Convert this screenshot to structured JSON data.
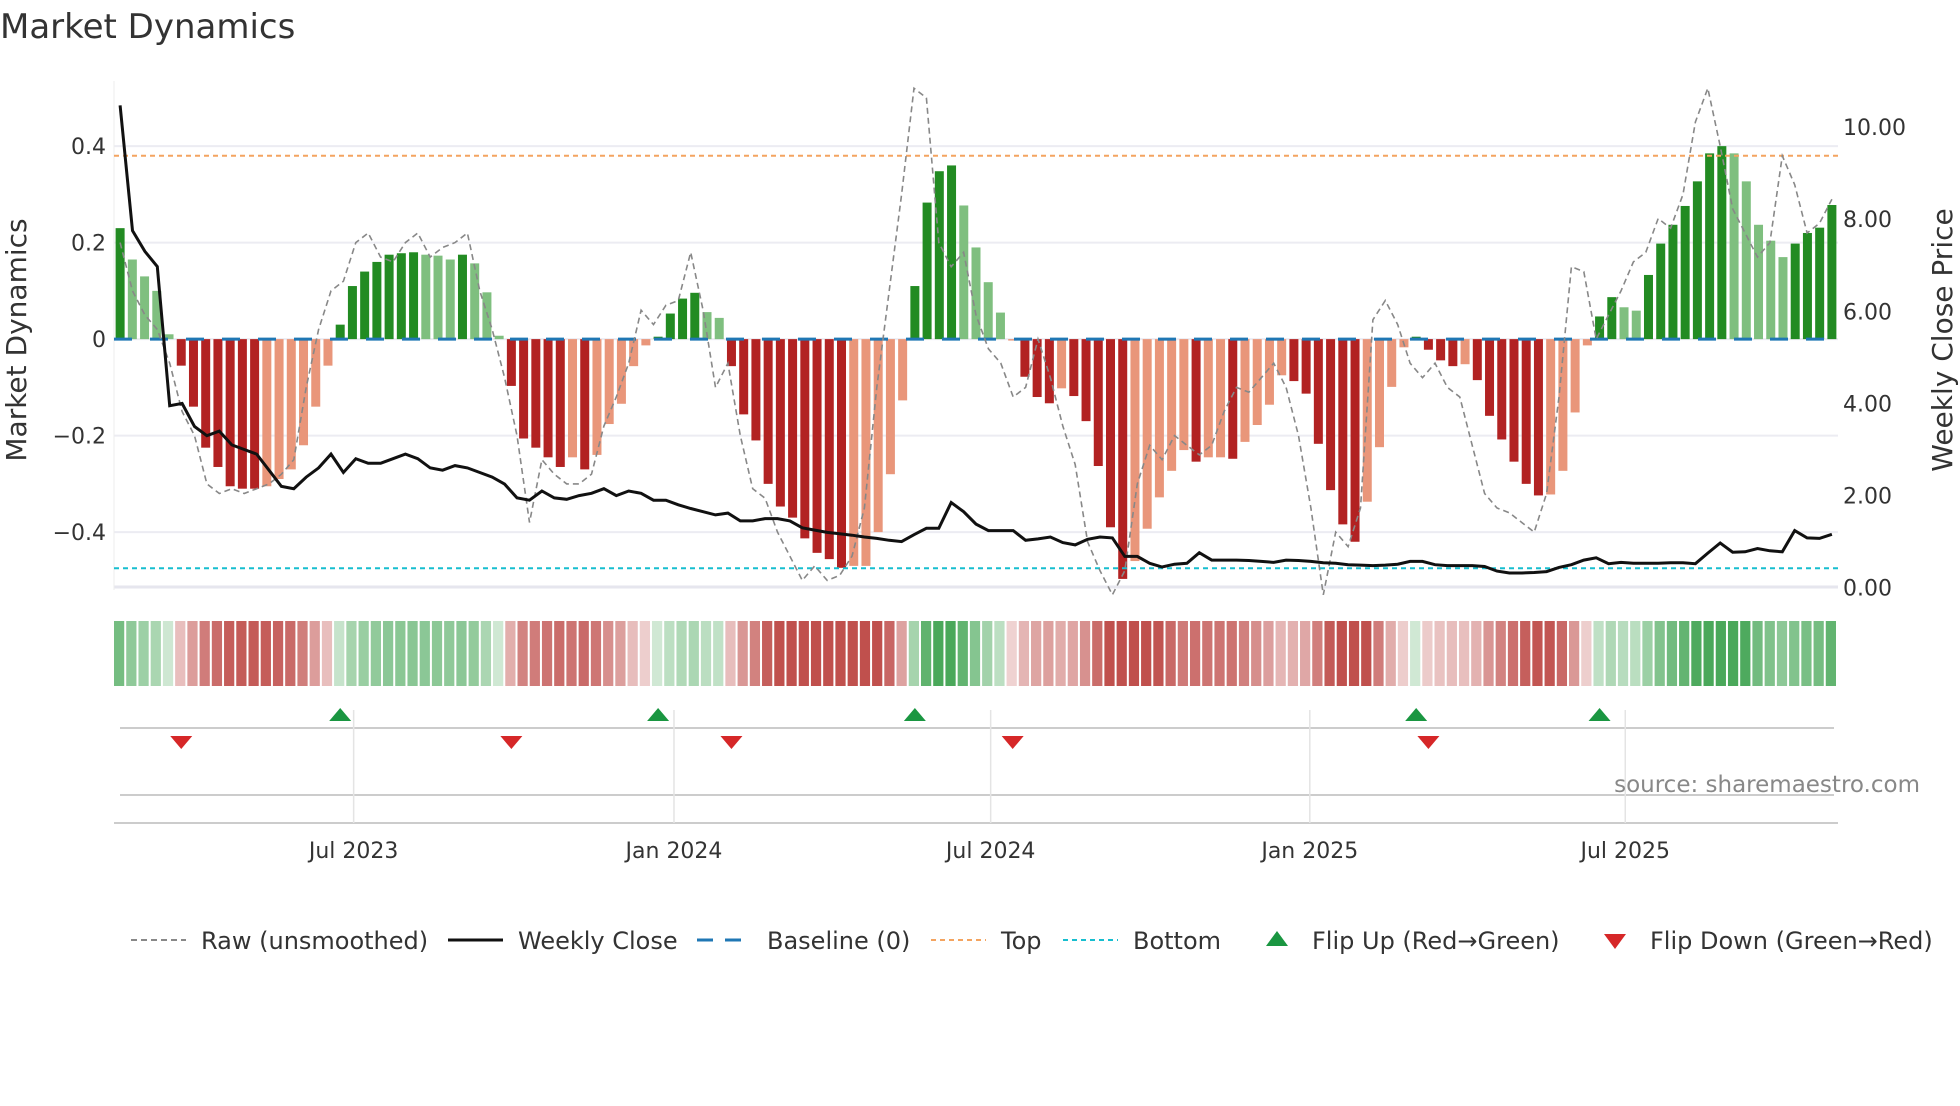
{
  "chart_data": {
    "type": "bar",
    "title": "Market Dynamics",
    "ylabel": "Market Dynamics",
    "y2label": "Weekly Close Price",
    "ylim": [
      -0.52,
      0.535
    ],
    "y2lim": [
      -0.05,
      11.0
    ],
    "yticks": [
      {
        "v": 0.4,
        "label": "0.4"
      },
      {
        "v": 0.2,
        "label": "0.2"
      },
      {
        "v": 0,
        "label": "0"
      },
      {
        "v": -0.2,
        "label": "−0.2"
      },
      {
        "v": -0.4,
        "label": "−0.4"
      }
    ],
    "y2ticks": [
      {
        "v": 10,
        "label": "10.00"
      },
      {
        "v": 8,
        "label": "8.00"
      },
      {
        "v": 6,
        "label": "6.00"
      },
      {
        "v": 4,
        "label": "4.00"
      },
      {
        "v": 2,
        "label": "2.00"
      },
      {
        "v": 0,
        "label": "0.00"
      }
    ],
    "xticks": [
      {
        "week": 19.6,
        "label": "Jul 2023"
      },
      {
        "week": 45.8,
        "label": "Jan 2024"
      },
      {
        "week": 71.7,
        "label": "Jul 2024"
      },
      {
        "week": 97.8,
        "label": "Jan 2025"
      },
      {
        "week": 123.6,
        "label": "Jul 2025"
      }
    ],
    "top_level": 0.38,
    "bottom_level": -0.475,
    "baseline": 0,
    "colors": {
      "green_strong": "#228b22",
      "green_weak": "#7fbf7f",
      "red_strong": "#b22222",
      "red_weak": "#e9967a",
      "top": "#f4a460",
      "bottom": "#17becf",
      "baseline": "#1f77b4",
      "flip_up": "#1a9641",
      "flip_down": "#d62728"
    },
    "smoothed": [
      0.23,
      0.165,
      0.13,
      0.1,
      0.01,
      -0.055,
      -0.14,
      -0.225,
      -0.265,
      -0.305,
      -0.31,
      -0.31,
      -0.305,
      -0.29,
      -0.27,
      -0.22,
      -0.14,
      -0.055,
      0.03,
      0.11,
      0.14,
      0.16,
      0.175,
      0.178,
      0.18,
      0.175,
      0.173,
      0.165,
      0.175,
      0.157,
      0.097,
      0.007,
      -0.097,
      -0.206,
      -0.225,
      -0.245,
      -0.265,
      -0.245,
      -0.27,
      -0.24,
      -0.176,
      -0.134,
      -0.056,
      -0.013,
      0.005,
      0.053,
      0.084,
      0.096,
      0.056,
      0.044,
      -0.056,
      -0.156,
      -0.21,
      -0.3,
      -0.347,
      -0.37,
      -0.413,
      -0.443,
      -0.456,
      -0.474,
      -0.47,
      -0.47,
      -0.4,
      -0.28,
      -0.127,
      0.11,
      0.283,
      0.348,
      0.36,
      0.277,
      0.19,
      0.118,
      0.055,
      -0.003,
      -0.078,
      -0.12,
      -0.133,
      -0.102,
      -0.118,
      -0.17,
      -0.263,
      -0.39,
      -0.497,
      -0.46,
      -0.393,
      -0.328,
      -0.273,
      -0.23,
      -0.254,
      -0.245,
      -0.245,
      -0.248,
      -0.213,
      -0.178,
      -0.136,
      -0.075,
      -0.087,
      -0.113,
      -0.217,
      -0.313,
      -0.384,
      -0.42,
      -0.337,
      -0.224,
      -0.099,
      -0.017,
      0.005,
      -0.022,
      -0.044,
      -0.056,
      -0.052,
      -0.085,
      -0.159,
      -0.208,
      -0.254,
      -0.3,
      -0.324,
      -0.322,
      -0.273,
      -0.152,
      -0.013,
      0.047,
      0.087,
      0.066,
      0.059,
      0.133,
      0.198,
      0.237,
      0.276,
      0.327,
      0.385,
      0.4,
      0.385,
      0.327,
      0.237,
      0.204,
      0.17,
      0.198,
      0.22,
      0.231,
      0.278
    ],
    "strength": [
      "s",
      "w",
      "w",
      "w",
      "w",
      "s",
      "s",
      "s",
      "s",
      "s",
      "s",
      "s",
      "w",
      "w",
      "w",
      "w",
      "w",
      "w",
      "s",
      "s",
      "s",
      "s",
      "s",
      "s",
      "s",
      "w",
      "w",
      "w",
      "s",
      "w",
      "w",
      "w",
      "s",
      "s",
      "s",
      "s",
      "s",
      "w",
      "s",
      "w",
      "w",
      "w",
      "w",
      "w",
      "s",
      "s",
      "s",
      "s",
      "w",
      "w",
      "s",
      "s",
      "s",
      "s",
      "s",
      "s",
      "s",
      "s",
      "s",
      "s",
      "w",
      "w",
      "w",
      "w",
      "w",
      "s",
      "s",
      "s",
      "s",
      "w",
      "w",
      "w",
      "w",
      "w",
      "s",
      "s",
      "s",
      "w",
      "s",
      "s",
      "s",
      "s",
      "s",
      "w",
      "w",
      "w",
      "w",
      "w",
      "s",
      "w",
      "w",
      "s",
      "w",
      "w",
      "w",
      "w",
      "s",
      "s",
      "s",
      "s",
      "s",
      "s",
      "w",
      "w",
      "w",
      "w",
      "s",
      "s",
      "s",
      "s",
      "w",
      "s",
      "s",
      "s",
      "s",
      "s",
      "s",
      "w",
      "w",
      "w",
      "w",
      "s",
      "s",
      "w",
      "w",
      "s",
      "s",
      "s",
      "s",
      "s",
      "s",
      "s",
      "w",
      "w",
      "w",
      "w",
      "w",
      "s",
      "s",
      "s",
      "s"
    ],
    "raw": [
      0.2,
      0.1,
      0.05,
      0.02,
      -0.05,
      -0.15,
      -0.2,
      -0.3,
      -0.32,
      -0.31,
      -0.32,
      -0.31,
      -0.3,
      -0.28,
      -0.25,
      -0.1,
      0.02,
      0.1,
      0.12,
      0.2,
      0.22,
      0.17,
      0.16,
      0.2,
      0.22,
      0.17,
      0.19,
      0.2,
      0.22,
      0.1,
      0.02,
      -0.08,
      -0.2,
      -0.38,
      -0.25,
      -0.28,
      -0.3,
      -0.3,
      -0.28,
      -0.18,
      -0.12,
      -0.05,
      0.06,
      0.03,
      0.07,
      0.08,
      0.18,
      0.06,
      -0.1,
      -0.05,
      -0.2,
      -0.31,
      -0.33,
      -0.4,
      -0.45,
      -0.5,
      -0.47,
      -0.5,
      -0.49,
      -0.45,
      -0.35,
      -0.1,
      0.1,
      0.3,
      0.52,
      0.5,
      0.2,
      0.15,
      0.18,
      0.05,
      -0.02,
      -0.05,
      -0.12,
      -0.1,
      0.0,
      -0.08,
      -0.18,
      -0.26,
      -0.42,
      -0.48,
      -0.53,
      -0.48,
      -0.3,
      -0.22,
      -0.25,
      -0.2,
      -0.22,
      -0.24,
      -0.22,
      -0.15,
      -0.1,
      -0.11,
      -0.08,
      -0.05,
      -0.1,
      -0.2,
      -0.35,
      -0.53,
      -0.4,
      -0.43,
      -0.35,
      0.04,
      0.08,
      0.03,
      -0.05,
      -0.08,
      -0.05,
      -0.1,
      -0.12,
      -0.22,
      -0.32,
      -0.35,
      -0.36,
      -0.38,
      -0.4,
      -0.32,
      -0.12,
      0.15,
      0.14,
      0.0,
      0.05,
      0.1,
      0.16,
      0.18,
      0.25,
      0.23,
      0.3,
      0.45,
      0.52,
      0.4,
      0.27,
      0.22,
      0.17,
      0.2,
      0.38,
      0.32,
      0.22,
      0.24,
      0.29
    ],
    "weekly_close": [
      10.47,
      7.75,
      7.3,
      6.97,
      3.95,
      4.0,
      3.5,
      3.3,
      3.4,
      3.1,
      3.0,
      2.9,
      2.55,
      2.2,
      2.15,
      2.4,
      2.6,
      2.9,
      2.5,
      2.8,
      2.7,
      2.7,
      2.8,
      2.9,
      2.8,
      2.6,
      2.55,
      2.65,
      2.6,
      2.5,
      2.4,
      2.25,
      1.95,
      1.9,
      2.1,
      1.95,
      1.92,
      2.0,
      2.05,
      2.15,
      2.0,
      2.1,
      2.05,
      1.9,
      1.9,
      1.8,
      1.72,
      1.65,
      1.58,
      1.62,
      1.45,
      1.45,
      1.5,
      1.5,
      1.45,
      1.3,
      1.25,
      1.2,
      1.17,
      1.14,
      1.1,
      1.07,
      1.03,
      1.0,
      1.15,
      1.29,
      1.29,
      1.85,
      1.65,
      1.38,
      1.24,
      1.24,
      1.24,
      1.03,
      1.06,
      1.1,
      0.98,
      0.93,
      1.05,
      1.1,
      1.08,
      0.68,
      0.68,
      0.53,
      0.45,
      0.51,
      0.53,
      0.76,
      0.6,
      0.6,
      0.6,
      0.59,
      0.57,
      0.55,
      0.6,
      0.59,
      0.57,
      0.54,
      0.53,
      0.5,
      0.49,
      0.48,
      0.49,
      0.51,
      0.57,
      0.57,
      0.5,
      0.48,
      0.48,
      0.48,
      0.46,
      0.36,
      0.32,
      0.32,
      0.33,
      0.35,
      0.44,
      0.5,
      0.6,
      0.65,
      0.52,
      0.55,
      0.53,
      0.53,
      0.53,
      0.54,
      0.54,
      0.52,
      0.75,
      0.97,
      0.77,
      0.78,
      0.85,
      0.8,
      0.78,
      1.24,
      1.08,
      1.07,
      1.16
    ],
    "flip_up_weeks": [
      18,
      44,
      65,
      106,
      121
    ],
    "flip_down_weeks": [
      5,
      32,
      50,
      73,
      107
    ],
    "legend": [
      {
        "key": "raw",
        "label": "Raw (unsmoothed)"
      },
      {
        "key": "close",
        "label": "Weekly Close"
      },
      {
        "key": "baseline",
        "label": "Baseline (0)"
      },
      {
        "key": "top",
        "label": "Top"
      },
      {
        "key": "bottom",
        "label": "Bottom"
      },
      {
        "key": "up",
        "label": "Flip Up (Red→Green)"
      },
      {
        "key": "down",
        "label": "Flip Down (Green→Red)"
      }
    ],
    "source": "source: sharemaestro.com"
  }
}
